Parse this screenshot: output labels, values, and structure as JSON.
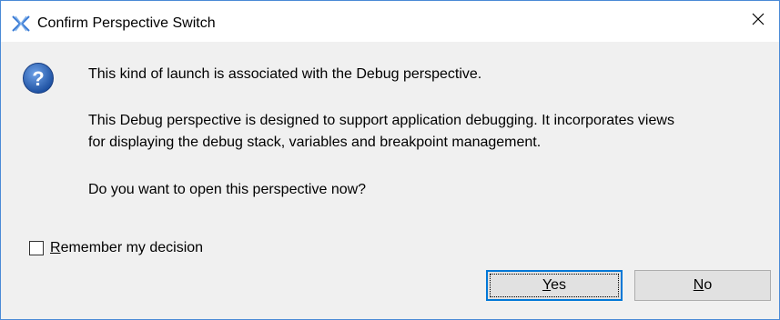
{
  "window": {
    "title": "Confirm Perspective Switch",
    "close_glyph": "close-icon",
    "border_color": "#4a8ad6"
  },
  "message": {
    "line1": "This kind of launch is associated with the Debug perspective.",
    "line2": "This Debug perspective is designed to support application debugging.  It incorporates views",
    "line3": "for displaying the debug stack, variables and breakpoint management.",
    "line4": "Do you want to open this perspective now?"
  },
  "remember": {
    "checked": false,
    "mnemonic": "R",
    "label_rest": "emember my decision"
  },
  "buttons": {
    "yes": {
      "mnemonic": "Y",
      "rest": "es",
      "default": true
    },
    "no": {
      "mnemonic": "N",
      "rest": "o",
      "default": false
    }
  },
  "icons": {
    "app": "perspective-switch-icon",
    "message": "question-icon"
  }
}
